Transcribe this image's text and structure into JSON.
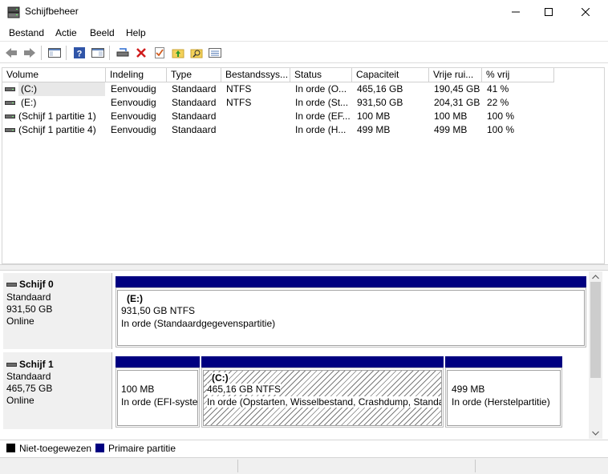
{
  "window": {
    "title": "Schijfbeheer",
    "icon": "disk-management-icon",
    "buttons": [
      "minimize-icon",
      "maximize-icon",
      "close-icon"
    ]
  },
  "menu": [
    "Bestand",
    "Actie",
    "Beeld",
    "Help"
  ],
  "toolbar": {
    "icons": [
      "back-arrow-icon",
      "forward-arrow-icon",
      "console-tree-icon",
      "help-icon",
      "show-hide-icon",
      "connect-drive-icon",
      "delete-icon",
      "properties-icon",
      "folder-up-icon",
      "folder-search-icon",
      "list-view-icon"
    ]
  },
  "volume_list": {
    "columns": [
      "Volume",
      "Indeling",
      "Type",
      "Bestandssys...",
      "Status",
      "Capaciteit",
      "Vrije rui...",
      "% vrij"
    ],
    "rows": [
      {
        "volume": "(C:)",
        "indeling": "Eenvoudig",
        "type": "Standaard",
        "fs": "NTFS",
        "status": "In orde (O...",
        "capaciteit": "465,16 GB",
        "vrij": "190,45 GB",
        "pct": "41 %"
      },
      {
        "volume": "(E:)",
        "indeling": "Eenvoudig",
        "type": "Standaard",
        "fs": "NTFS",
        "status": "In orde (St...",
        "capaciteit": "931,50 GB",
        "vrij": "204,31 GB",
        "pct": "22 %"
      },
      {
        "volume": "(Schijf 1 partitie 1)",
        "indeling": "Eenvoudig",
        "type": "Standaard",
        "fs": "",
        "status": "In orde (EF...",
        "capaciteit": "100 MB",
        "vrij": "100 MB",
        "pct": "100 %"
      },
      {
        "volume": "(Schijf 1 partitie 4)",
        "indeling": "Eenvoudig",
        "type": "Standaard",
        "fs": "",
        "status": "In orde (H...",
        "capaciteit": "499 MB",
        "vrij": "499 MB",
        "pct": "100 %"
      }
    ]
  },
  "disks": [
    {
      "name": "Schijf 0",
      "type": "Standaard",
      "size": "931,50 GB",
      "state": "Online",
      "partitions": [
        {
          "label": "(E:)",
          "line1": "931,50 GB NTFS",
          "line2": "In orde (Standaardgegevenspartitie)"
        }
      ]
    },
    {
      "name": "Schijf 1",
      "type": "Standaard",
      "size": "465,75 GB",
      "state": "Online",
      "partitions": [
        {
          "label": "",
          "line1": "100 MB",
          "line2": "In orde (EFI-syste"
        },
        {
          "label": "(C:)",
          "line1": "465,16 GB NTFS",
          "line2": "In orde (Opstarten, Wisselbestand, Crashdump, Standa"
        },
        {
          "label": "",
          "line1": "499 MB",
          "line2": "In orde (Herstelpartitie)"
        }
      ]
    }
  ],
  "legend": [
    {
      "label": "Niet-toegewezen",
      "color": "#000000"
    },
    {
      "label": "Primaire partitie",
      "color": "#000080"
    }
  ]
}
